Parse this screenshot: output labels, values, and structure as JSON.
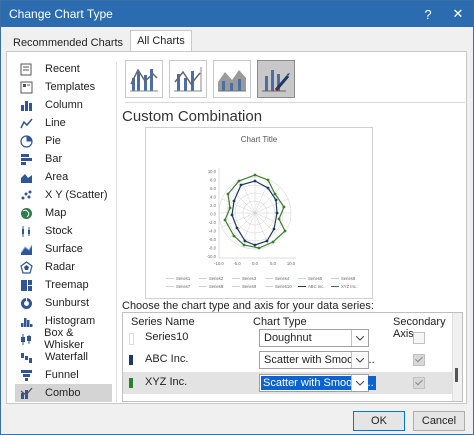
{
  "window": {
    "title": "Change Chart Type",
    "help_icon": "?",
    "close_icon": "✕"
  },
  "tabs": [
    {
      "label": "Recommended Charts"
    },
    {
      "label": "All Charts"
    }
  ],
  "chart_types": [
    {
      "label": "Recent",
      "icon": "recent-icon"
    },
    {
      "label": "Templates",
      "icon": "templates-icon"
    },
    {
      "label": "Column",
      "icon": "column-chart-icon"
    },
    {
      "label": "Line",
      "icon": "line-chart-icon"
    },
    {
      "label": "Pie",
      "icon": "pie-chart-icon"
    },
    {
      "label": "Bar",
      "icon": "bar-chart-icon"
    },
    {
      "label": "Area",
      "icon": "area-chart-icon"
    },
    {
      "label": "X Y (Scatter)",
      "icon": "scatter-chart-icon"
    },
    {
      "label": "Map",
      "icon": "map-chart-icon"
    },
    {
      "label": "Stock",
      "icon": "stock-chart-icon"
    },
    {
      "label": "Surface",
      "icon": "surface-chart-icon"
    },
    {
      "label": "Radar",
      "icon": "radar-chart-icon"
    },
    {
      "label": "Treemap",
      "icon": "treemap-chart-icon"
    },
    {
      "label": "Sunburst",
      "icon": "sunburst-chart-icon"
    },
    {
      "label": "Histogram",
      "icon": "histogram-chart-icon"
    },
    {
      "label": "Box & Whisker",
      "icon": "box-whisker-chart-icon"
    },
    {
      "label": "Waterfall",
      "icon": "waterfall-chart-icon"
    },
    {
      "label": "Funnel",
      "icon": "funnel-chart-icon"
    },
    {
      "label": "Combo",
      "icon": "combo-chart-icon",
      "selected": true
    }
  ],
  "heading": "Custom Combination",
  "preview": {
    "title": "Chart Title",
    "y_ticks": [
      "10.0",
      "8.0",
      "6.0",
      "4.0",
      "2.0",
      "0.0",
      "-2.0",
      "-4.0",
      "-6.0",
      "-8.0",
      "-10.0"
    ],
    "x_ticks": [
      "-10.0",
      "-5.0",
      "0.0",
      "5.0",
      "10.0"
    ],
    "legend_row1": [
      "Series1",
      "Series2",
      "Series3",
      "Series4",
      "Series5",
      "Series6"
    ],
    "legend_row2": [
      "Series7",
      "Series8",
      "Series9",
      "Series10",
      "ABC Inc.",
      "XYZ Inc."
    ]
  },
  "series_section": {
    "label": "Choose the chart type and axis for your data series:",
    "columns": {
      "name": "Series Name",
      "type": "Chart Type",
      "axis": "Secondary Axis"
    },
    "rows": [
      {
        "name": "Series10",
        "type": "Doughnut",
        "secondary": false,
        "color": "#ffffff"
      },
      {
        "name": "ABC Inc.",
        "type": "Scatter with Smooth ...",
        "secondary": true,
        "color": "#1f3864"
      },
      {
        "name": "XYZ Inc.",
        "type": "Scatter with Smooth ...",
        "secondary": true,
        "color": "#2e7d32"
      }
    ]
  },
  "buttons": {
    "ok": "OK",
    "cancel": "Cancel"
  },
  "colors": {
    "accent": "#2b6cb0",
    "abc_series": "#1f3864",
    "xyz_series": "#3a7d2c",
    "selection": "#0b63d1"
  }
}
